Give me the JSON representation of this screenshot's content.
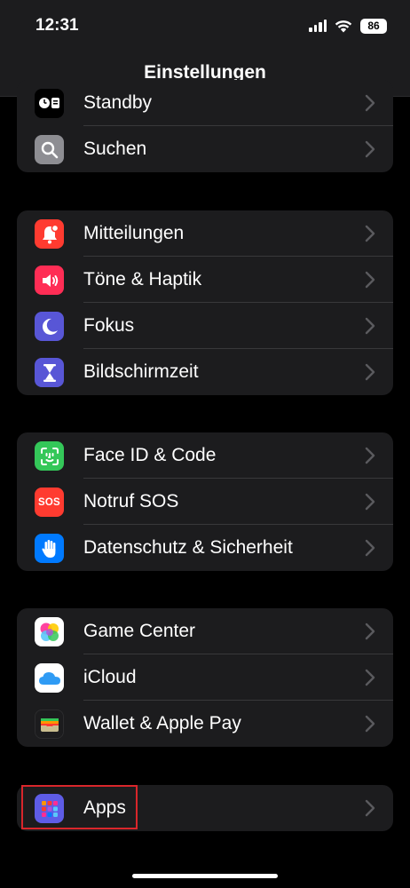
{
  "status": {
    "time": "12:31",
    "battery": "86"
  },
  "header": {
    "title": "Einstellungen"
  },
  "groups": [
    {
      "items": [
        {
          "label": "Standby",
          "icon": "standby-icon",
          "color": "#1c1c1e"
        },
        {
          "label": "Suchen",
          "icon": "search-icon",
          "color": "#8e8e93"
        }
      ]
    },
    {
      "items": [
        {
          "label": "Mitteilungen",
          "icon": "bell-icon",
          "color": "#ff3b30"
        },
        {
          "label": "Töne & Haptik",
          "icon": "speaker-icon",
          "color": "#ff2d55"
        },
        {
          "label": "Fokus",
          "icon": "moon-icon",
          "color": "#5856d6"
        },
        {
          "label": "Bildschirmzeit",
          "icon": "hourglass-icon",
          "color": "#5856d6"
        }
      ]
    },
    {
      "items": [
        {
          "label": "Face ID & Code",
          "icon": "face-id-icon",
          "color": "#34c759"
        },
        {
          "label": "Notruf SOS",
          "icon": "sos-icon",
          "color": "#ff3b30",
          "icon_text": "SOS"
        },
        {
          "label": "Datenschutz & Sicherheit",
          "icon": "hand-icon",
          "color": "#007aff"
        }
      ]
    },
    {
      "items": [
        {
          "label": "Game Center",
          "icon": "game-center-icon",
          "color": "#ffffff"
        },
        {
          "label": "iCloud",
          "icon": "cloud-icon",
          "color": "#ffffff"
        },
        {
          "label": "Wallet & Apple Pay",
          "icon": "wallet-icon",
          "color": "#1c1c1e"
        }
      ]
    },
    {
      "items": [
        {
          "label": "Apps",
          "icon": "apps-grid-icon",
          "color": "#5e5ce6"
        }
      ]
    }
  ]
}
